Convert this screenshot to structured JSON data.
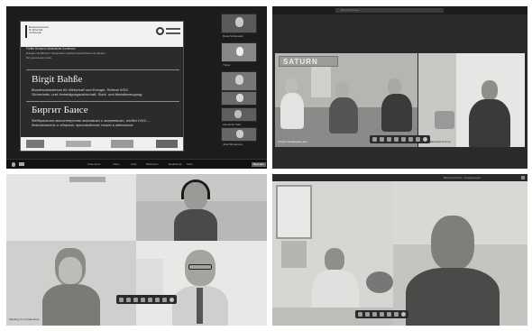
{
  "q1": {
    "slide": {
      "header_lines": [
        "Fünfte Deutsch-Ukrainische Konferenz",
        "Energie und Effizienz: Kooperation zwischen Deutschland und Ukraine",
        "Вступительное слово"
      ],
      "name_de": "Birgit Bahße",
      "role_de": "Bundesministerium für Wirtschaft und Energie, Referat IVD3\nSicherheits- und Verteidigungswirtschaft, Stahl- und Metallerzeugung",
      "name_ru": "Биргит Баисе",
      "role_ru": "Федеральное министерство экономики и энергетики, отдел IVD3 –\nбезопасность и оборона, производство стали и металлов"
    },
    "participants": [
      "Dana Strobowski",
      "Yuliya",
      "Waldemar Sing...",
      "",
      "Alexander Sab...",
      "Julia Moryakova"
    ],
    "toolbar": [
      "Teilnehmer",
      "Video",
      "Chat",
      "Bildschirm",
      "Reaktionen",
      "Mehr",
      "Beenden"
    ]
  },
  "q2": {
    "app_title": "Microsoft Teams",
    "banner": "SATURN",
    "label_left": "Сатурн Конференц-зал",
    "label_right": "Олег Иванченко (Гость)"
  },
  "q3": {
    "label_bottom": "Meeting room (Valentina)"
  },
  "q4": {
    "app_title": "Microsoft Teams - Конференция"
  }
}
